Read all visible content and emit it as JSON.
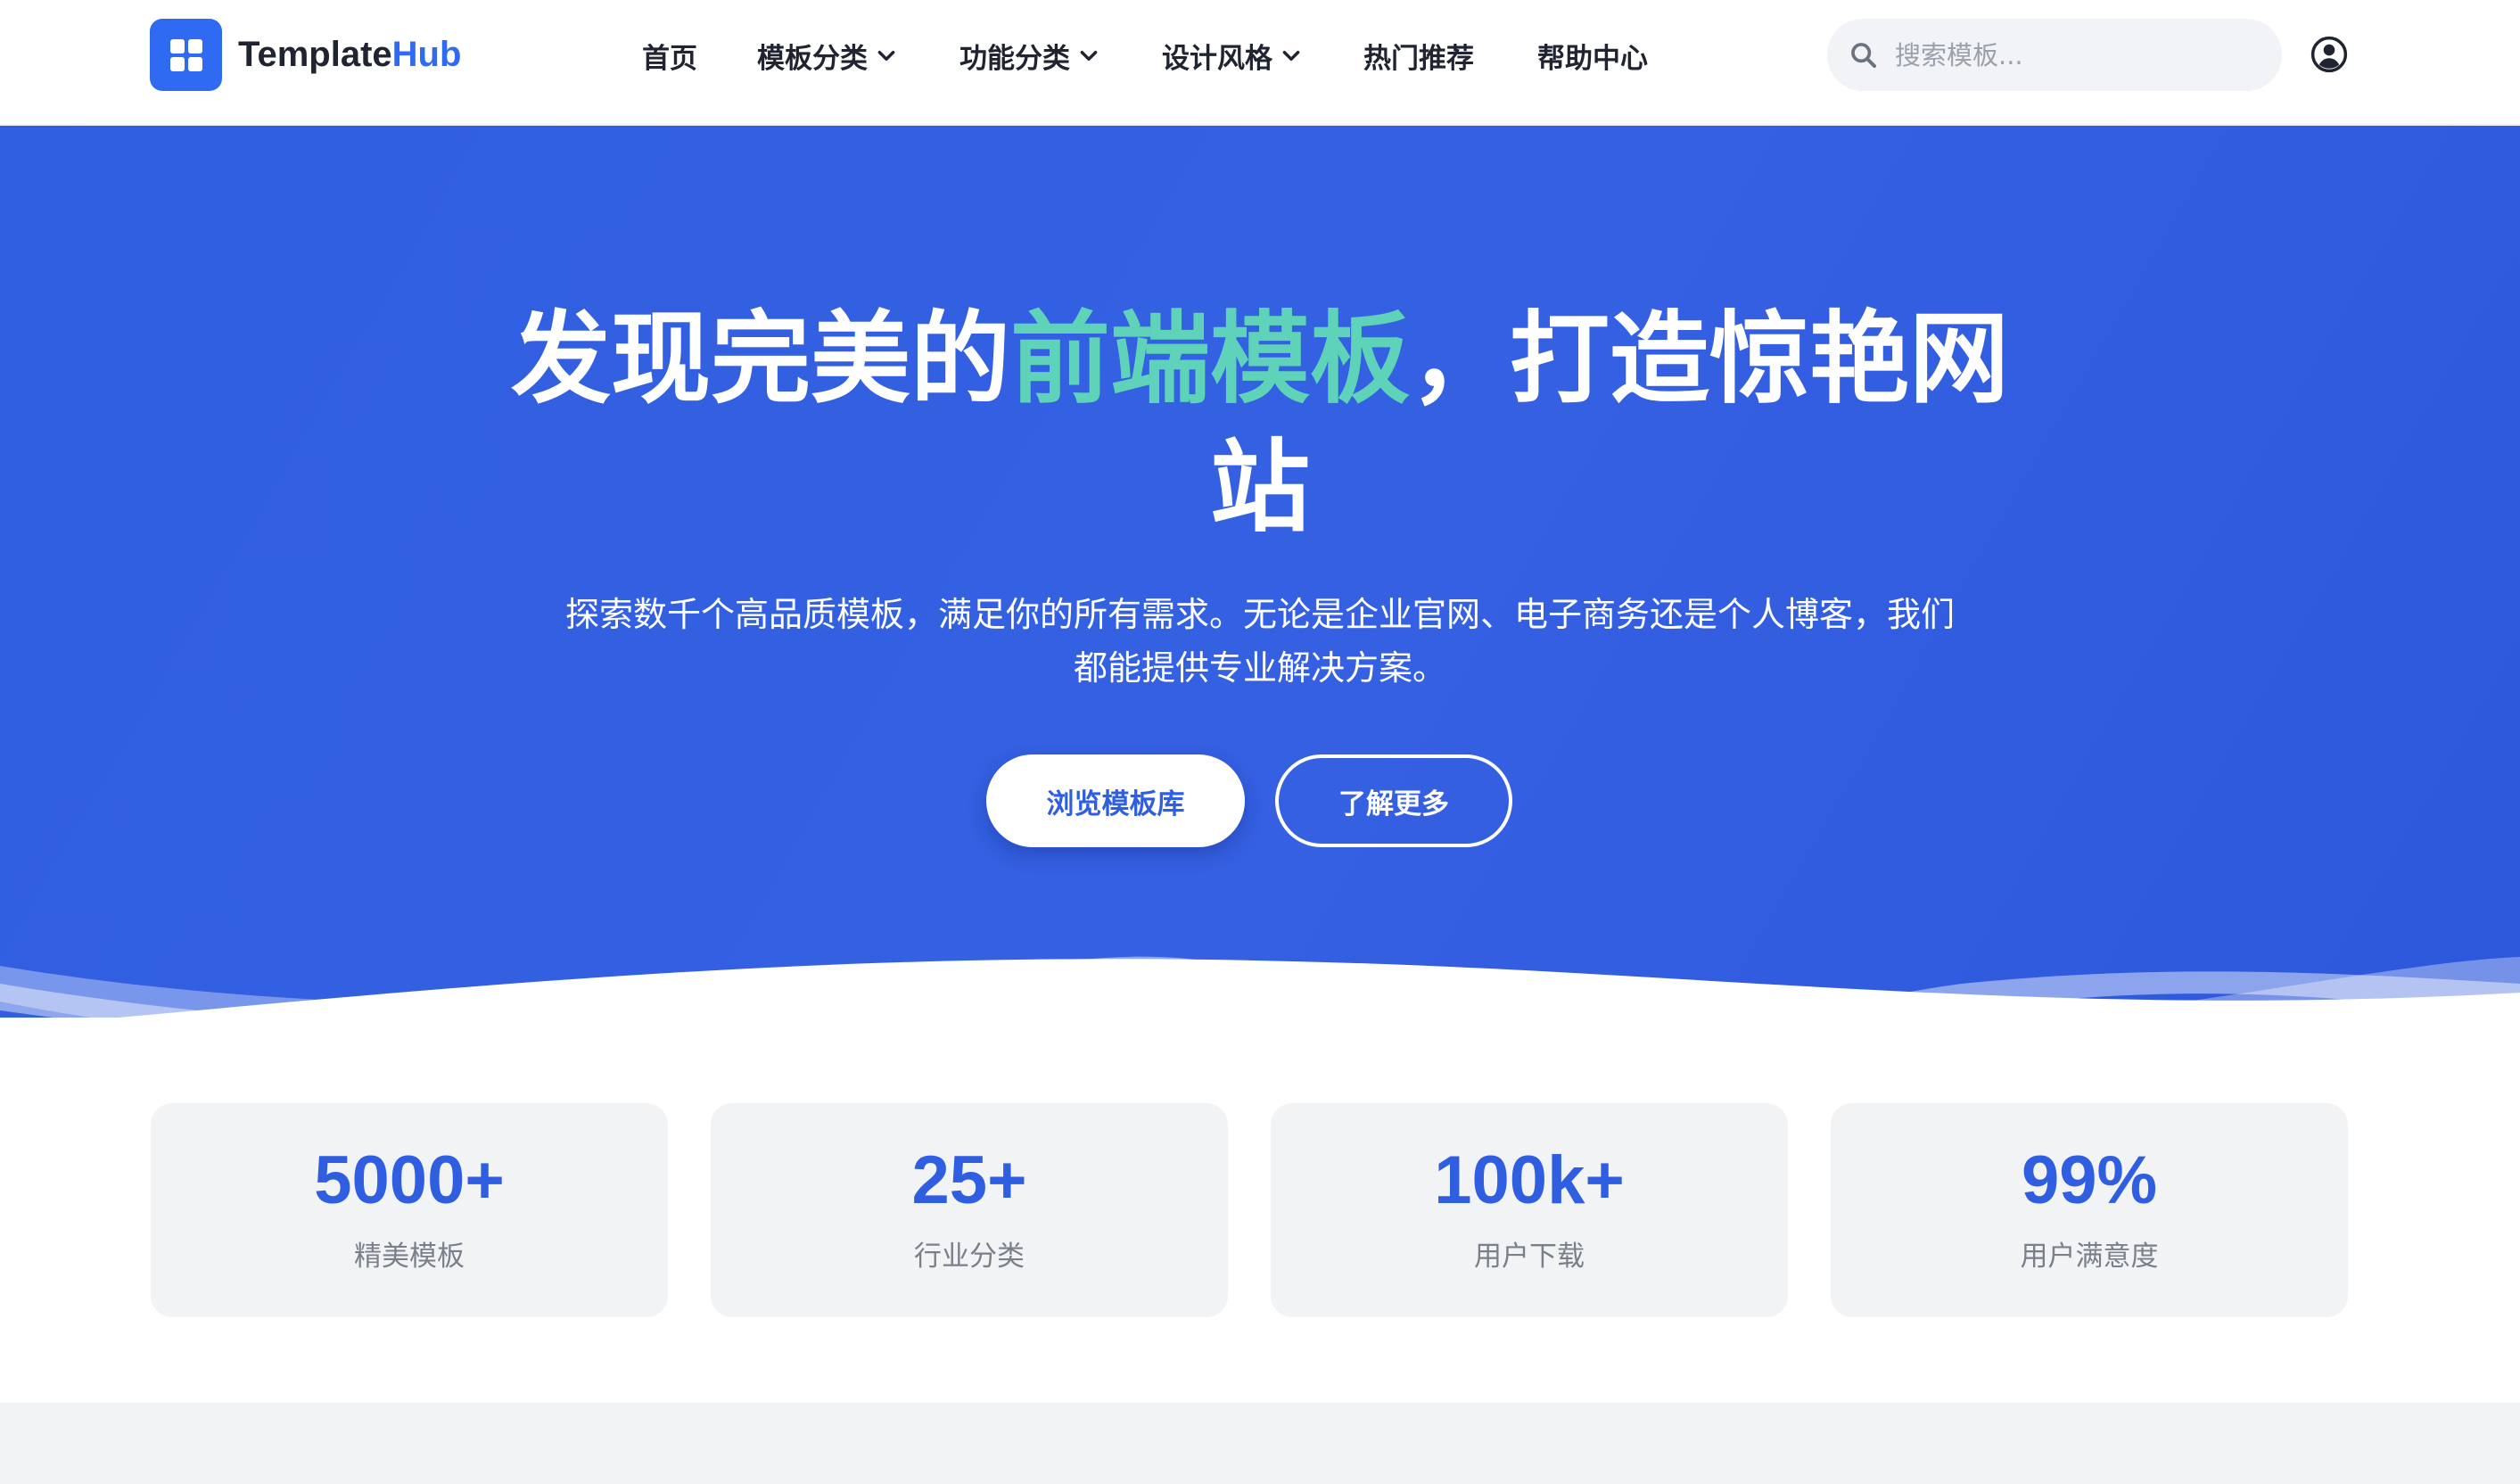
{
  "brand": {
    "name_part1": "Template",
    "name_part2": "Hub",
    "primary_color": "#2f6bf2",
    "accent_color": "#5fd3b9"
  },
  "nav": {
    "items": [
      {
        "label": "首页",
        "has_dropdown": false
      },
      {
        "label": "模板分类",
        "has_dropdown": true
      },
      {
        "label": "功能分类",
        "has_dropdown": true
      },
      {
        "label": "设计风格",
        "has_dropdown": true
      },
      {
        "label": "热门推荐",
        "has_dropdown": false
      },
      {
        "label": "帮助中心",
        "has_dropdown": false
      }
    ]
  },
  "search": {
    "placeholder": "搜索模板...",
    "icon": "search-icon"
  },
  "user": {
    "icon": "user-circle-icon"
  },
  "hero": {
    "title_part1": "发现完美的",
    "title_highlight": "前端模板",
    "title_part2": "，打造惊艳网站",
    "subtitle": "探索数千个高品质模板，满足你的所有需求。无论是企业官网、电子商务还是个人博客，我们都能提供专业解决方案。",
    "primary_button": "浏览模板库",
    "secondary_button": "了解更多"
  },
  "stats": [
    {
      "value": "5000+",
      "label": "精美模板"
    },
    {
      "value": "25+",
      "label": "行业分类"
    },
    {
      "value": "100k+",
      "label": "用户下载"
    },
    {
      "value": "99%",
      "label": "用户满意度"
    }
  ]
}
